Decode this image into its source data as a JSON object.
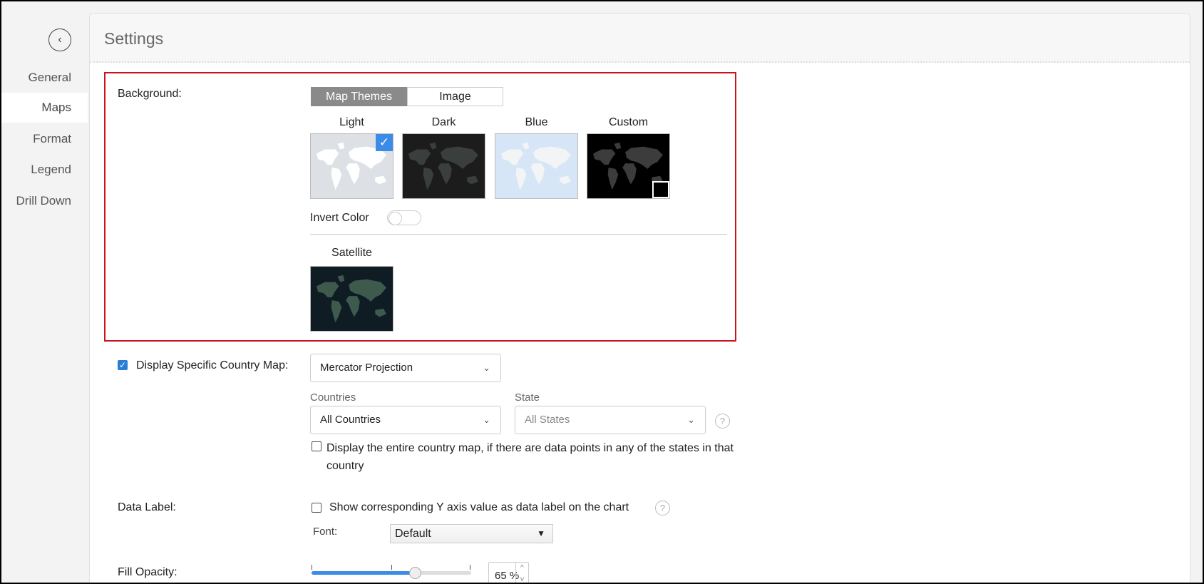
{
  "sidebar": {
    "back_icon": "chevron-left-icon",
    "items": [
      {
        "label": "General"
      },
      {
        "label": "Maps",
        "active": true
      },
      {
        "label": "Format"
      },
      {
        "label": "Legend"
      },
      {
        "label": "Drill Down"
      }
    ]
  },
  "header": {
    "title": "Settings"
  },
  "background": {
    "label": "Background:",
    "tabs": [
      "Map Themes",
      "Image"
    ],
    "active_tab": "Map Themes",
    "themes": [
      {
        "label": "Light",
        "selected": true,
        "bg": "#dde1e6",
        "land": "#ffffff"
      },
      {
        "label": "Dark",
        "bg": "#1c1c1c",
        "land": "#3a3f3d"
      },
      {
        "label": "Blue",
        "bg": "#d6e6f7",
        "land": "#f2f4f5"
      },
      {
        "label": "Custom",
        "bg": "#000000",
        "land": "#3c3c3c"
      }
    ],
    "invert_color": {
      "label": "Invert Color",
      "on": false
    },
    "satellite": {
      "label": "Satellite"
    }
  },
  "country_map": {
    "checked": true,
    "label": "Display Specific Country Map:",
    "projection": "Mercator Projection",
    "countries_label": "Countries",
    "countries_value": "All Countries",
    "state_label": "State",
    "state_value": "All States",
    "entire_map_checked": false,
    "entire_map_label": "Display the entire country map, if there are data points in any of the states in that country"
  },
  "data_label": {
    "label": "Data Label:",
    "checked": false,
    "checkbox_label": "Show corresponding Y axis value as data label on the chart",
    "font_label": "Font:",
    "font_value": "Default"
  },
  "fill_opacity": {
    "label": "Fill Opacity:",
    "value_percent": 65,
    "value_text": "65 %"
  },
  "colors": {
    "accent": "#3d8be8",
    "highlight_border": "#c8141c"
  }
}
